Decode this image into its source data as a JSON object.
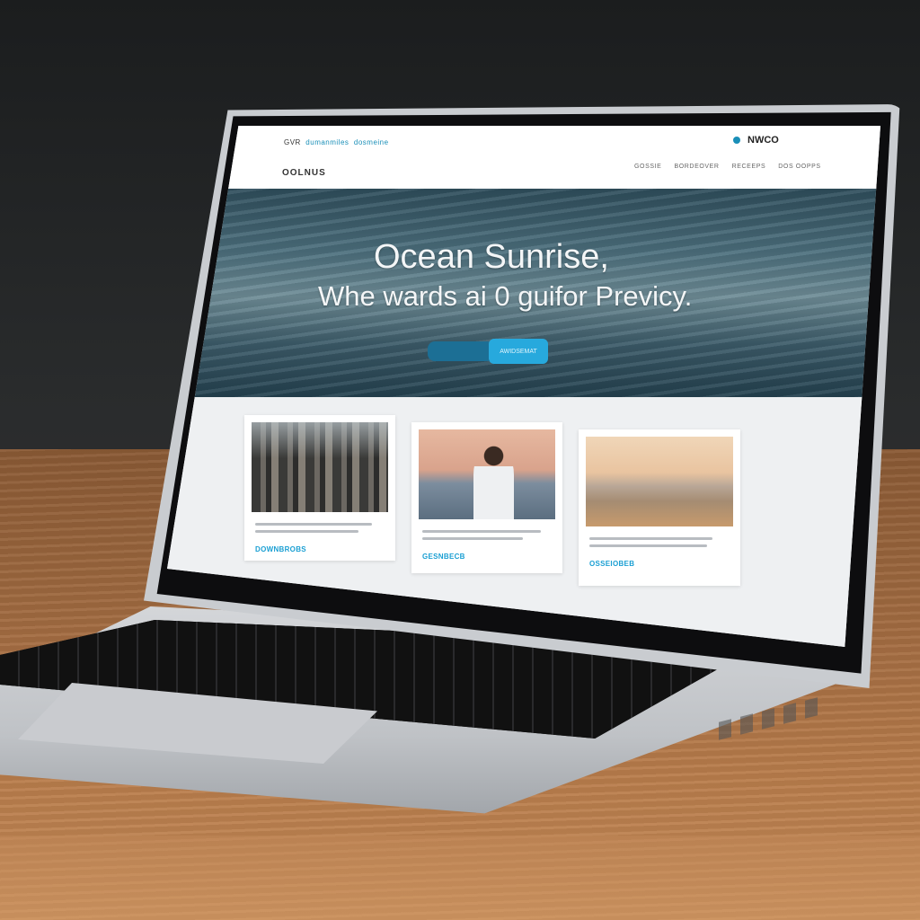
{
  "webpage": {
    "topbar": {
      "left_text": "GVR",
      "left_link": "dumanmiles",
      "left_link2": "dosmeine",
      "right_text": "NWCO"
    },
    "navbar": {
      "logo": "OOLNUS",
      "links": [
        "GOSSIE",
        "BORDEOVER",
        "RECEEPS",
        "DOS OOPPS"
      ]
    },
    "hero": {
      "title": "Ocean Sunrise,",
      "subtitle": "Whe wards ai  0 guifor Previcy.",
      "button_label": "AWIDSEMAT"
    },
    "cards": [
      {
        "image": "city-skyline",
        "more_label": "DOWNBROBS"
      },
      {
        "image": "person-at-sea",
        "more_label": "GESNBECB"
      },
      {
        "image": "beach-sunset",
        "more_label": "OSSEIOBEB"
      }
    ]
  },
  "colors": {
    "accent": "#27a9dd",
    "hero_dark": "#2f4e5c",
    "page_bg": "#f4f6f8"
  }
}
